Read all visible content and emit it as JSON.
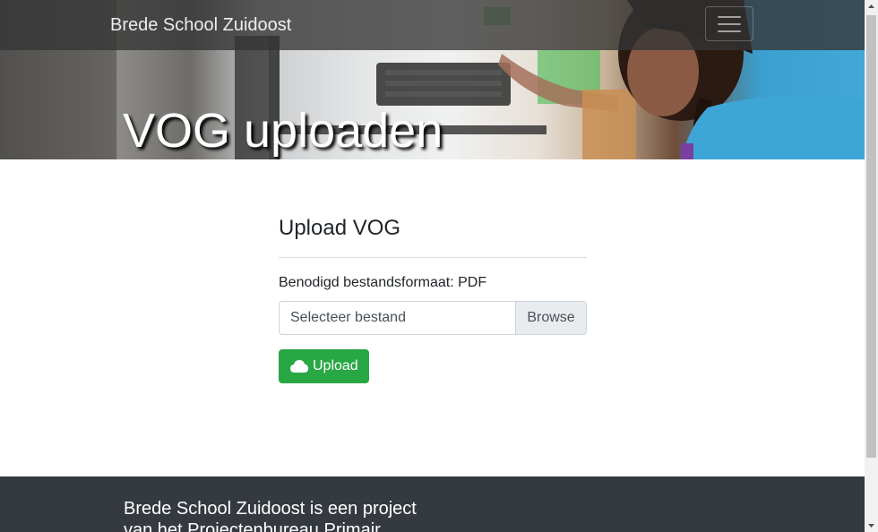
{
  "navbar": {
    "brand": "Brede School Zuidoost",
    "menu_icon": "hamburger-menu-icon"
  },
  "hero": {
    "title": "VOG uploaden"
  },
  "upload": {
    "heading": "Upload VOG",
    "format_label": "Benodigd bestandsformaat: PDF",
    "file_placeholder": "Selecteer bestand",
    "browse_label": "Browse",
    "button_label": "Upload",
    "button_icon": "cloud-icon"
  },
  "footer": {
    "text": "Brede School Zuidoost is een project van het Projectenbureau Primair"
  },
  "colors": {
    "navbar_bg": "#343434",
    "success": "#28a745",
    "footer_bg": "#343a40",
    "text": "#212529"
  }
}
